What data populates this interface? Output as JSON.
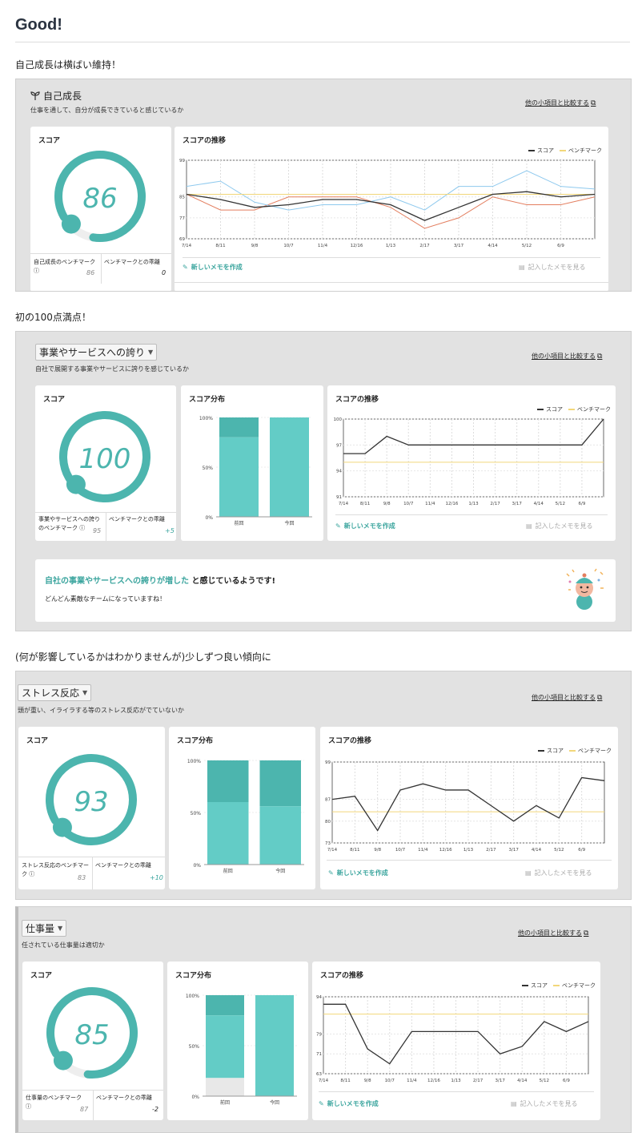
{
  "page": {
    "title": "Good!",
    "captions": [
      "自己成長は横ばい維持！",
      "初の100点満点！",
      "(何が影響しているかはわかりませんが)少しずつ良い傾向に"
    ]
  },
  "common": {
    "score_label": "スコア",
    "trend_label": "スコアの推移",
    "dist_label": "スコア分布",
    "compare_link": "他の小項目と比較する",
    "new_memo": "新しいメモを作成",
    "view_memos": "記入したメモを見る",
    "legend_score": "スコア",
    "legend_bench": "ベンチマーク",
    "bench_diff_label": "ベンチマークとの乖離",
    "dist_prev": "前回",
    "dist_now": "今回",
    "dist_ticks": [
      "100%",
      "50%",
      "0%"
    ]
  },
  "colors": {
    "accent": "#4cb5ae",
    "bench": "#f2d77a",
    "score_line": "#333333",
    "blue_line": "#8ec9ee",
    "red_line": "#e37e5f"
  },
  "sections": [
    {
      "name": "自己成長",
      "icon": "sprout-icon",
      "desc": "仕事を通して、自分が成長できていると感じているか",
      "score": 86,
      "bench_label": "自己成長のベンチマーク",
      "bench_value": "86",
      "bench_diff": "0",
      "chart_data": {
        "type": "line",
        "x": [
          "7/14",
          "8/11",
          "9/8",
          "10/7",
          "11/4",
          "12/16",
          "1/13",
          "2/17",
          "3/17",
          "4/14",
          "5/12",
          "6/9"
        ],
        "yticks": [
          99,
          85,
          77,
          69
        ],
        "ylim": [
          69,
          99
        ],
        "series": [
          {
            "name": "スコア",
            "values": [
              86,
              84,
              81,
              82,
              84,
              84,
              82,
              76,
              81,
              86,
              87,
              85,
              86
            ]
          },
          {
            "name": "ベンチマーク",
            "values": [
              86,
              86,
              86,
              86,
              86,
              86,
              86,
              86,
              86,
              86,
              86,
              86,
              86
            ]
          },
          {
            "values": [
              89,
              91,
              83,
              80,
              82,
              82,
              85,
              80,
              89,
              89,
              95,
              89,
              88
            ]
          },
          {
            "values": [
              86,
              80,
              80,
              85,
              85,
              85,
              81,
              73,
              77,
              85,
              82,
              82,
              85
            ]
          }
        ]
      }
    },
    {
      "name": "事業やサービスへの誇り",
      "desc": "自社で展開する事業やサービスに誇りを感じているか",
      "score": 100,
      "bench_label": "事業やサービスへの誇りのベンチマーク",
      "bench_value": "95",
      "bench_diff": "+5",
      "dist": {
        "prev": [
          20,
          80
        ],
        "now": [
          0,
          100
        ]
      },
      "message": {
        "highlight": "自社の事業やサービスへの誇りが増した",
        "rest": "と感じているようです!",
        "sub": "どんどん素敵なチームになっていますね！"
      },
      "chart_data": {
        "type": "line",
        "x": [
          "7/14",
          "8/11",
          "9/8",
          "10/7",
          "11/4",
          "12/16",
          "1/13",
          "2/17",
          "3/17",
          "4/14",
          "5/12",
          "6/9"
        ],
        "yticks": [
          100,
          97,
          94,
          91
        ],
        "ylim": [
          91,
          100
        ],
        "series": [
          {
            "name": "スコア",
            "values": [
              96,
              96,
              98,
              97,
              97,
              97,
              97,
              97,
              97,
              97,
              97,
              97,
              100
            ]
          },
          {
            "name": "ベンチマーク",
            "values": [
              95,
              95,
              95,
              95,
              95,
              95,
              95,
              95,
              95,
              95,
              95,
              95,
              95
            ]
          }
        ]
      }
    },
    {
      "name": "ストレス反応",
      "desc": "頭が重い、イライラする等のストレス反応がでていないか",
      "score": 93,
      "bench_label": "ストレス反応のベンチマーク",
      "bench_value": "83",
      "bench_diff": "+10",
      "dist": {
        "prev": [
          40,
          60
        ],
        "now": [
          44,
          56
        ]
      },
      "chart_data": {
        "type": "line",
        "x": [
          "7/14",
          "8/11",
          "9/8",
          "10/7",
          "11/4",
          "12/16",
          "1/13",
          "2/17",
          "3/17",
          "4/14",
          "5/12",
          "6/9"
        ],
        "yticks": [
          99,
          87,
          80,
          73
        ],
        "ylim": [
          73,
          99
        ],
        "series": [
          {
            "name": "スコア",
            "values": [
              87,
              88,
              77,
              90,
              92,
              90,
              90,
              85,
              80,
              85,
              81,
              94,
              93
            ]
          },
          {
            "name": "ベンチマーク",
            "values": [
              83,
              83,
              83,
              83,
              83,
              83,
              83,
              83,
              83,
              83,
              83,
              83,
              83
            ]
          }
        ]
      }
    },
    {
      "name": "仕事量",
      "desc": "任されている仕事量は適切か",
      "score": 85,
      "bench_label": "仕事量のベンチマーク",
      "bench_value": "87",
      "bench_diff": "-2",
      "dist": {
        "prev": [
          20,
          62,
          18
        ],
        "now": [
          0,
          100,
          0
        ]
      },
      "chart_data": {
        "type": "line",
        "x": [
          "7/14",
          "8/11",
          "9/8",
          "10/7",
          "11/4",
          "12/16",
          "1/13",
          "2/17",
          "3/17",
          "4/14",
          "5/12",
          "6/9"
        ],
        "yticks": [
          94,
          79,
          71,
          63
        ],
        "ylim": [
          63,
          94
        ],
        "series": [
          {
            "name": "スコア",
            "values": [
              91,
              91,
              73,
              67,
              80,
              80,
              80,
              80,
              71,
              74,
              84,
              80,
              84
            ]
          },
          {
            "name": "ベンチマーク",
            "values": [
              87,
              87,
              87,
              87,
              87,
              87,
              87,
              87,
              87,
              87,
              87,
              87,
              87
            ]
          }
        ]
      }
    }
  ]
}
